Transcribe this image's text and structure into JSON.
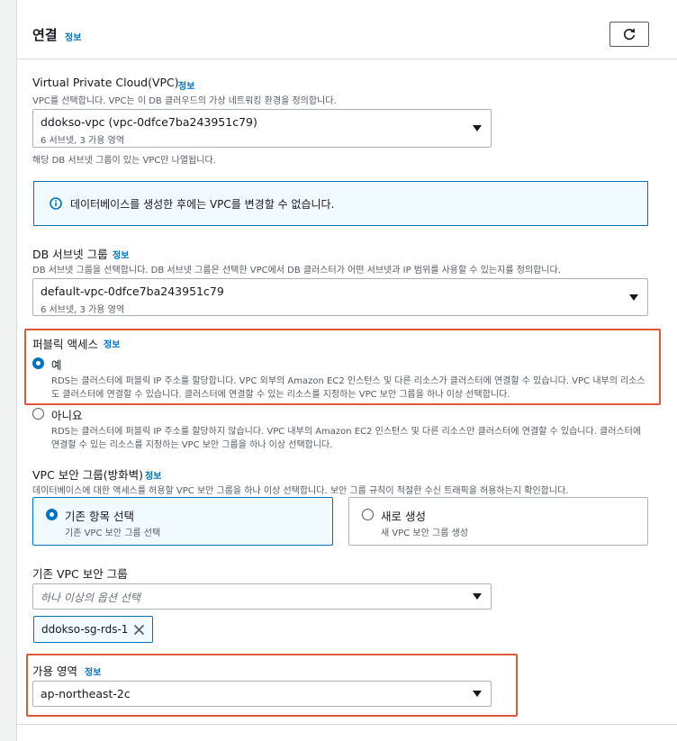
{
  "header": {
    "title": "연결",
    "info": "정보"
  },
  "vpc": {
    "label": "Virtual Private Cloud(VPC)",
    "info": "정보",
    "description": "VPC를 선택합니다. VPC는 이 DB 클러우드의 가상 네트워킹 환경을 정의합니다.",
    "value": "ddokso-vpc (vpc-0dfce7ba243951c79)",
    "sub": "6 서브넷, 3 가용 영역",
    "hint": "해당 DB 서브넷 그룹이 있는 VPC만 나열됩니다."
  },
  "alert": {
    "text": "데이터베이스를 생성한 후에는 VPC를 변경할 수 없습니다."
  },
  "subnet": {
    "label": "DB 서브넷 그룹",
    "info": "정보",
    "description": "DB 서브넷 그룹을 선택합니다. DB 서브넷 그룹은 선택한 VPC에서 DB 클러스터가 어떤 서브넷과 IP 범위를 사용할 수 있는지를 정의합니다.",
    "value": "default-vpc-0dfce7ba243951c79",
    "sub": "6 서브넷, 3 가용 영역"
  },
  "public_access": {
    "label": "퍼블릭 액세스",
    "info": "정보",
    "options": [
      {
        "label": "예",
        "desc1": "RDS는 클러스터에 퍼블릭 IP 주소를 할당합니다. VPC 외부의 Amazon EC2 인스턴스 및 다른 리소스가 클러스터에 연결할 수 있습니다. VPC 내부의 리소스",
        "desc2": "도 클러스터에 연결할 수 있습니다. 클러스터에 연결할 수 있는 리소스를 지정하는 VPC 보안 그룹을 하나 이상 선택합니다.",
        "selected": true
      },
      {
        "label": "아니요",
        "desc1": "RDS는 클러스터에 퍼블릭 IP 주소를 할당하지 않습니다. VPC 내부의 Amazon EC2 인스턴스 및 다른 리소스만 클러스터에 연결할 수 있습니다. 클러스터에",
        "desc2": "연결할 수 있는 리소스를 지정하는 VPC 보안 그룹을 하나 이상 선택합니다.",
        "selected": false
      }
    ]
  },
  "security": {
    "label": "VPC 보안 그룹(방화벽)",
    "info": "정보",
    "description": "데이터베이스에 대한 액세스를 허용할 VPC 보안 그룹을 하나 이상 선택합니다. 보안 그룹 규칙이 적절한 수신 트래픽을 허용하는지 확인합니다.",
    "options": [
      {
        "label": "기존 항목 선택",
        "sub": "기존 VPC 보안 그룹 선택",
        "selected": true
      },
      {
        "label": "새로 생성",
        "sub": "새 VPC 보안 그룹 생성",
        "selected": false
      }
    ]
  },
  "existing_sg": {
    "label": "기존 VPC 보안 그룹",
    "placeholder": "하나 이상의 옵션 선택",
    "tokens": [
      "ddokso-sg-rds-1"
    ]
  },
  "az": {
    "label": "가용 영역",
    "info": "정보",
    "value": "ap-northeast-2c"
  },
  "colors": {
    "accent": "#0073bb",
    "highlight": "#e0573c",
    "text": "#16191f",
    "muted": "#545b64"
  },
  "icons": [
    "refresh-icon",
    "info-circle-icon",
    "caret-down-icon",
    "close-icon"
  ]
}
